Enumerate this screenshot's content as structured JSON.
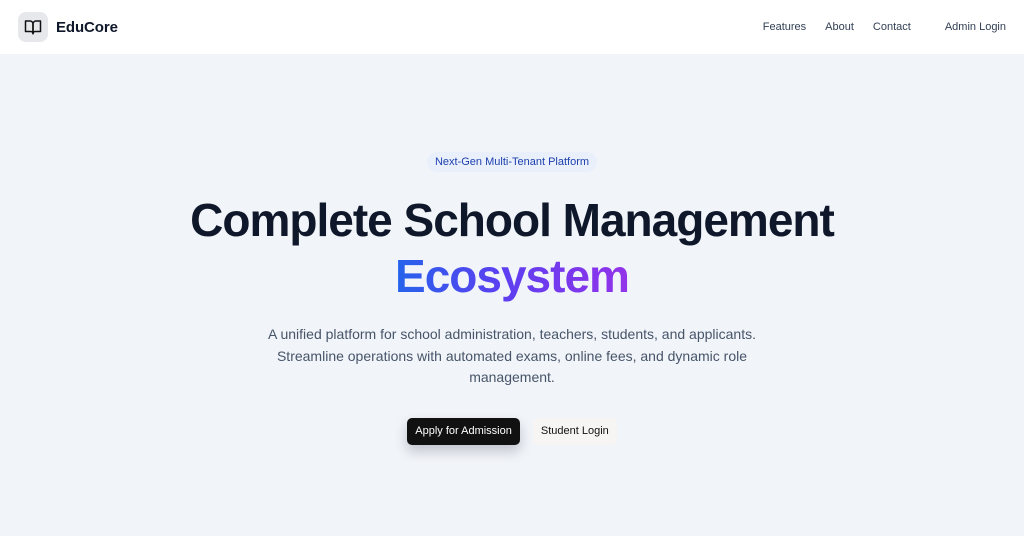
{
  "brand": {
    "name": "EduCore",
    "logo_icon": "book-open-icon"
  },
  "nav": {
    "features": "Features",
    "about": "About",
    "contact": "Contact",
    "admin_login": "Admin Login"
  },
  "hero": {
    "badge": "Next-Gen Multi-Tenant Platform",
    "title_line1": "Complete School Management",
    "title_line2": "Ecosystem",
    "subtitle": "A unified platform for school administration, teachers, students, and applicants. Streamline operations with automated exams, online fees, and dynamic role management.",
    "primary_cta": "Apply for Admission",
    "secondary_cta": "Student Login"
  },
  "colors": {
    "background": "#f1f4f9",
    "header": "#ffffff",
    "text_dark": "#0f172a",
    "badge_text": "#1e40af",
    "gradient_start": "#2563eb",
    "gradient_end": "#9333ea",
    "primary_button": "#111111"
  }
}
